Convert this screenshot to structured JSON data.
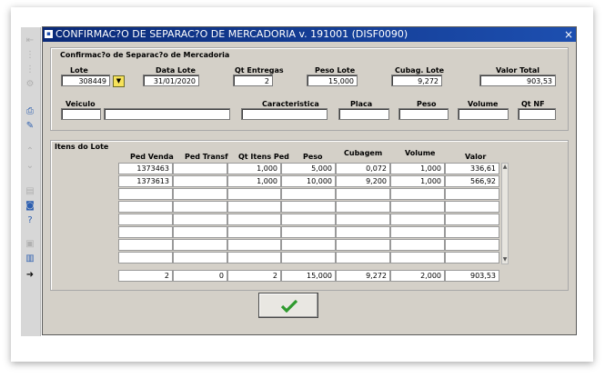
{
  "window": {
    "title": "CONFIRMAC?O DE SEPARAC?O DE MERCADORIA v. 191001 (DISF0090)",
    "close_glyph": "×",
    "app_icon": "app-icon"
  },
  "toolbar": {
    "icons": [
      "first-record-icon",
      "prev-record-icon",
      "next-record-icon",
      "last-record-icon",
      "query-icon",
      "clear-icon",
      "print-icon",
      "up-icon",
      "down-icon",
      "edit-icon",
      "camera-icon",
      "help-icon",
      "lock-icon",
      "trash-icon",
      "exit-icon"
    ]
  },
  "header_panel": {
    "title": "Confirmac?o de Separac?o de Mercadoria",
    "labels": {
      "lote": "Lote",
      "data_lote": "Data Lote",
      "qt_entregas": "Qt Entregas",
      "peso_lote": "Peso Lote",
      "cubag_lote": "Cubag. Lote",
      "valor_total": "Valor Total",
      "veiculo": "Veiculo",
      "caracteristica": "Caracteristica",
      "placa": "Placa",
      "peso": "Peso",
      "volume": "Volume",
      "qt_nf": "Qt NF"
    },
    "values": {
      "lote": "308449",
      "data_lote": "31/01/2020",
      "qt_entregas": "2",
      "peso_lote": "15,000",
      "cubag_lote": "9,272",
      "valor_total": "903,53",
      "veiculo_code": "",
      "veiculo_desc": "",
      "caracteristica": "",
      "placa": "",
      "peso": "",
      "volume": "",
      "qt_nf": ""
    },
    "dropdown_glyph": "▼"
  },
  "items_panel": {
    "title": "Itens do Lote",
    "columns": [
      "Ped Venda",
      "Ped Transf",
      "Qt Itens Ped",
      "Peso",
      "Cubagem",
      "Volume",
      "Valor"
    ],
    "rows": [
      [
        "1373463",
        "",
        "1,000",
        "5,000",
        "0,072",
        "1,000",
        "336,61"
      ],
      [
        "1373613",
        "",
        "1,000",
        "10,000",
        "9,200",
        "1,000",
        "566,92"
      ],
      [
        "",
        "",
        "",
        "",
        "",
        "",
        ""
      ],
      [
        "",
        "",
        "",
        "",
        "",
        "",
        ""
      ],
      [
        "",
        "",
        "",
        "",
        "",
        "",
        ""
      ],
      [
        "",
        "",
        "",
        "",
        "",
        "",
        ""
      ],
      [
        "",
        "",
        "",
        "",
        "",
        "",
        ""
      ],
      [
        "",
        "",
        "",
        "",
        "",
        "",
        ""
      ]
    ],
    "totals": [
      "2",
      "0",
      "2",
      "15,000",
      "9,272",
      "2,000",
      "903,53"
    ]
  },
  "ok_button": {
    "icon": "checkmark-icon",
    "color": "#2e9a2e"
  }
}
